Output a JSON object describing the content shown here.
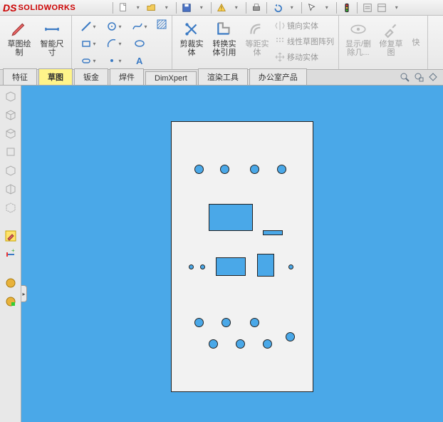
{
  "app": {
    "brand": "SOLIDWORKS"
  },
  "ribbon": {
    "sketch_draw": "草图绘制",
    "smart_dim": "智能尺寸",
    "trim": "剪裁实体",
    "convert": "转换实体引用",
    "offset": "等距实体",
    "mirror": "镜向实体",
    "pattern": "线性草图阵列",
    "move": "移动实体",
    "showhide": "显示/删除几...",
    "repair": "修复草图",
    "quick": "快"
  },
  "tabs": {
    "feature": "特征",
    "sketch": "草图",
    "sheetmetal": "钣金",
    "weldment": "焊件",
    "dimxpert": "DimXpert",
    "render": "渲染工具",
    "office": "办公室产品"
  }
}
